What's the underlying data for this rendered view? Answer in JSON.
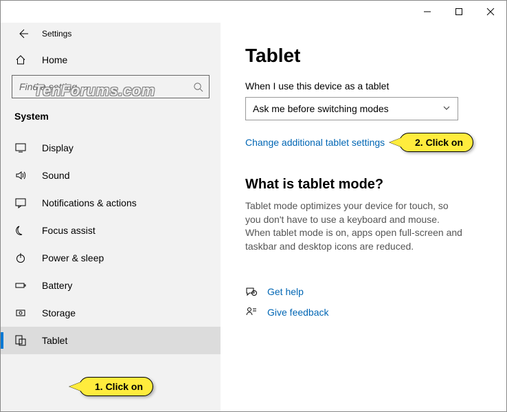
{
  "window": {
    "app_title": "Settings"
  },
  "sidebar": {
    "home_label": "Home",
    "search_placeholder": "Find a setting",
    "group_label": "System",
    "items": [
      {
        "label": "Display"
      },
      {
        "label": "Sound"
      },
      {
        "label": "Notifications & actions"
      },
      {
        "label": "Focus assist"
      },
      {
        "label": "Power & sleep"
      },
      {
        "label": "Battery"
      },
      {
        "label": "Storage"
      },
      {
        "label": "Tablet"
      }
    ]
  },
  "content": {
    "page_title": "Tablet",
    "setting1_label": "When I use this device as a tablet",
    "setting1_value": "Ask me before switching modes",
    "link_additional": "Change additional tablet settings",
    "section_title": "What is tablet mode?",
    "description": "Tablet mode optimizes your device for touch, so you don't have to use a keyboard and mouse. When tablet mode is on, apps open full-screen and taskbar and desktop icons are reduced.",
    "help_label": "Get help",
    "feedback_label": "Give feedback"
  },
  "annotations": {
    "callout1": "1. Click on",
    "callout2": "2. Click on"
  },
  "watermark": "TenForums.com"
}
